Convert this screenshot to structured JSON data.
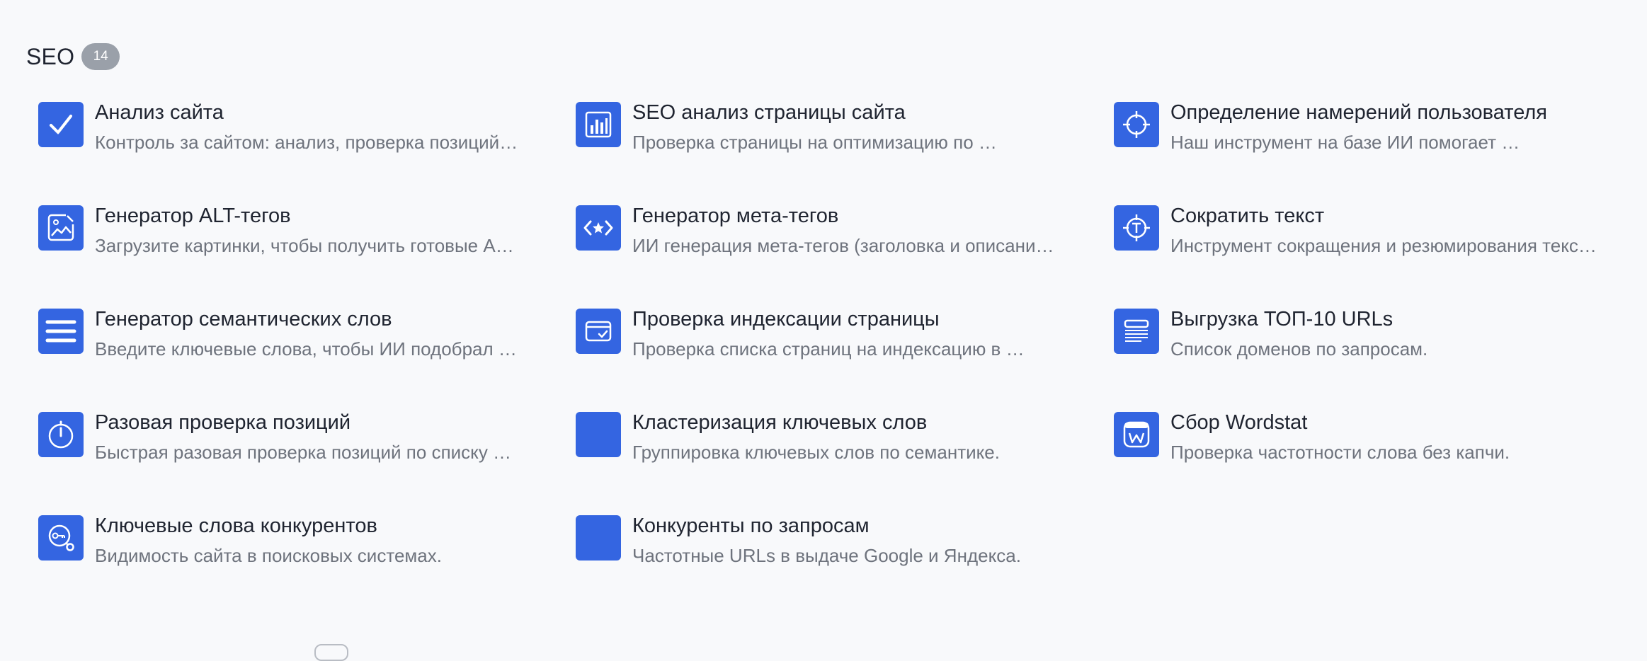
{
  "section": {
    "title": "SEO",
    "count": "14"
  },
  "tools": [
    {
      "title": "Анализ сайта",
      "description": "Контроль за сайтом: анализ, проверка позиций…",
      "icon": "check-icon"
    },
    {
      "title": "SEO анализ страницы сайта",
      "description": "Проверка страницы на оптимизацию по …",
      "icon": "bar-chart-icon"
    },
    {
      "title": "Определение намерений пользователя",
      "description": "Наш инструмент на базе ИИ помогает …",
      "icon": "crosshair-icon"
    },
    {
      "title": "Генератор ALT-тегов",
      "description": "Загрузите картинки, чтобы получить готовые A…",
      "icon": "image-edit-icon"
    },
    {
      "title": "Генератор мета-тегов",
      "description": "ИИ генерация мета-тегов (заголовка и описани…",
      "icon": "code-star-icon"
    },
    {
      "title": "Сократить текст",
      "description": "Инструмент сокращения и резюмирования текс…",
      "icon": "text-target-icon"
    },
    {
      "title": "Генератор семантических слов",
      "description": "Введите ключевые слова, чтобы ИИ подобрал …",
      "icon": "menu-lines-icon"
    },
    {
      "title": "Проверка индексации страницы",
      "description": "Проверка списка страниц на индексацию в …",
      "icon": "card-check-icon"
    },
    {
      "title": "Выгрузка ТОП-10 URLs",
      "description": "Список доменов по запросам.",
      "icon": "document-list-icon"
    },
    {
      "title": "Разовая проверка позиций",
      "description": "Быстрая разовая проверка позиций по списку …",
      "icon": "stopwatch-icon"
    },
    {
      "title": "Кластеризация ключевых слов",
      "description": "Группировка ключевых слов по семантике.",
      "icon": "blank-icon"
    },
    {
      "title": "Сбор Wordstat",
      "description": "Проверка частотности слова без капчи.",
      "icon": "wordstat-icon"
    },
    {
      "title": "Ключевые слова конкурентов",
      "description": "Видимость сайта в поисковых системах.",
      "icon": "key-search-icon"
    },
    {
      "title": "Конкуренты по запросам",
      "description": "Частотные URLs в выдаче Google и Яндекса.",
      "icon": "blank-icon"
    }
  ],
  "colors": {
    "accent": "#3465e1",
    "background": "#f8f9fb",
    "title": "#1f2430",
    "description": "#6e737d",
    "badge": "#9aa0a9"
  }
}
